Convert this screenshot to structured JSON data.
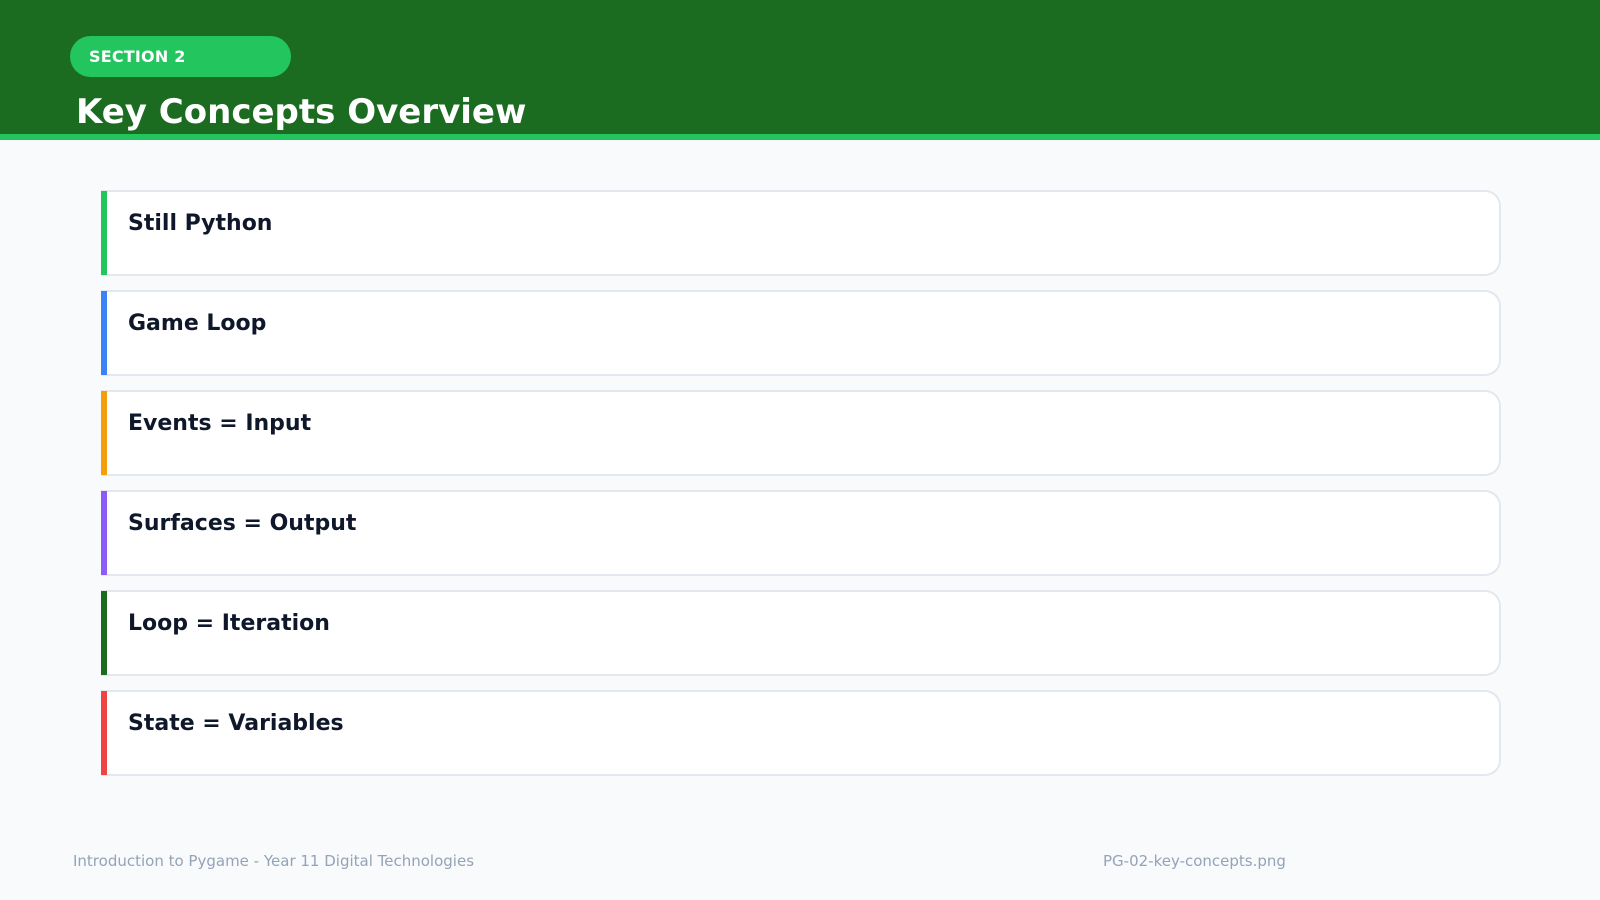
{
  "header": {
    "section_label": "SECTION 2",
    "title": "Key Concepts Overview"
  },
  "concepts": [
    {
      "label": "Still Python",
      "accent_color": "#22c55e"
    },
    {
      "label": "Game Loop",
      "accent_color": "#3b82f6"
    },
    {
      "label": "Events = Input",
      "accent_color": "#f59e0b"
    },
    {
      "label": "Surfaces = Output",
      "accent_color": "#8b5cf6"
    },
    {
      "label": "Loop = Iteration",
      "accent_color": "#1b6b20"
    },
    {
      "label": "State = Variables",
      "accent_color": "#ef4444"
    }
  ],
  "footer": {
    "course": "Introduction to Pygame - Year 11 Digital Technologies",
    "filename": "PG-02-key-concepts.png"
  },
  "colors": {
    "header_background": "#1b6b20",
    "header_stripe": "#22c55e",
    "badge": "#22c55e",
    "page_background": "#f8fafc",
    "card_border": "#e3e8ef",
    "footer_text": "#94a3b8"
  }
}
